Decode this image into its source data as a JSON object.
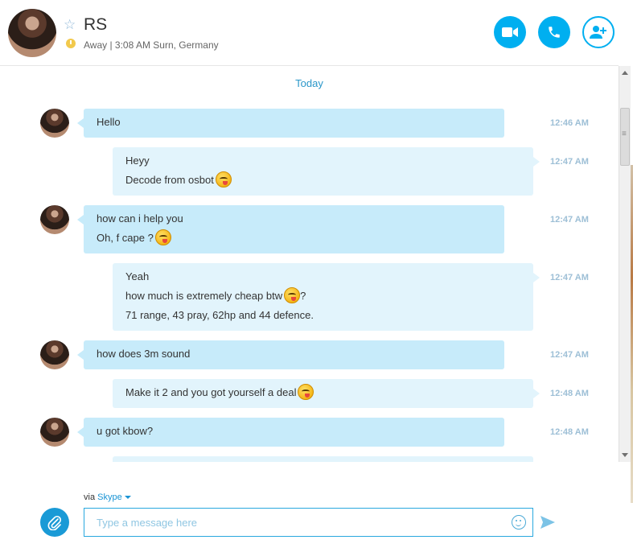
{
  "header": {
    "name": "RS",
    "status": "Away | 3:08 AM Surn, Germany"
  },
  "chat": {
    "date_divider": "Today",
    "messages": [
      {
        "dir": "in",
        "lines": [
          "Hello"
        ],
        "time": "12:46 AM"
      },
      {
        "dir": "out",
        "lines": [
          "Heyy",
          "Decode from osbot"
        ],
        "time": "12:47 AM"
      },
      {
        "dir": "in",
        "lines": [
          "how can i help you",
          "Oh, f cape ?"
        ],
        "time": "12:47 AM"
      },
      {
        "dir": "out",
        "lines": [
          "Yeah",
          "how much is extremely cheap btw",
          "?",
          "71 range, 43 pray, 62hp and 44 defence."
        ],
        "time": "12:47 AM"
      },
      {
        "dir": "in",
        "lines": [
          "how does 3m sound"
        ],
        "time": "12:47 AM"
      },
      {
        "dir": "out",
        "lines": [
          "Make it 2 and you got yourself a deal"
        ],
        "time": "12:48 AM"
      },
      {
        "dir": "in",
        "lines": [
          "u got kbow?"
        ],
        "time": "12:48 AM"
      }
    ]
  },
  "composer": {
    "via_label": "via",
    "service": "Skype",
    "placeholder": "Type a message here"
  },
  "colors": {
    "accent": "#00aff0",
    "incoming_bubble": "#c7ebfa",
    "outgoing_bubble": "#e2f4fc"
  },
  "icons": [
    "star-icon",
    "clock-icon",
    "video-call-icon",
    "phone-icon",
    "add-contact-icon",
    "emoji-icon",
    "attach-icon",
    "smiley-icon",
    "send-icon"
  ]
}
